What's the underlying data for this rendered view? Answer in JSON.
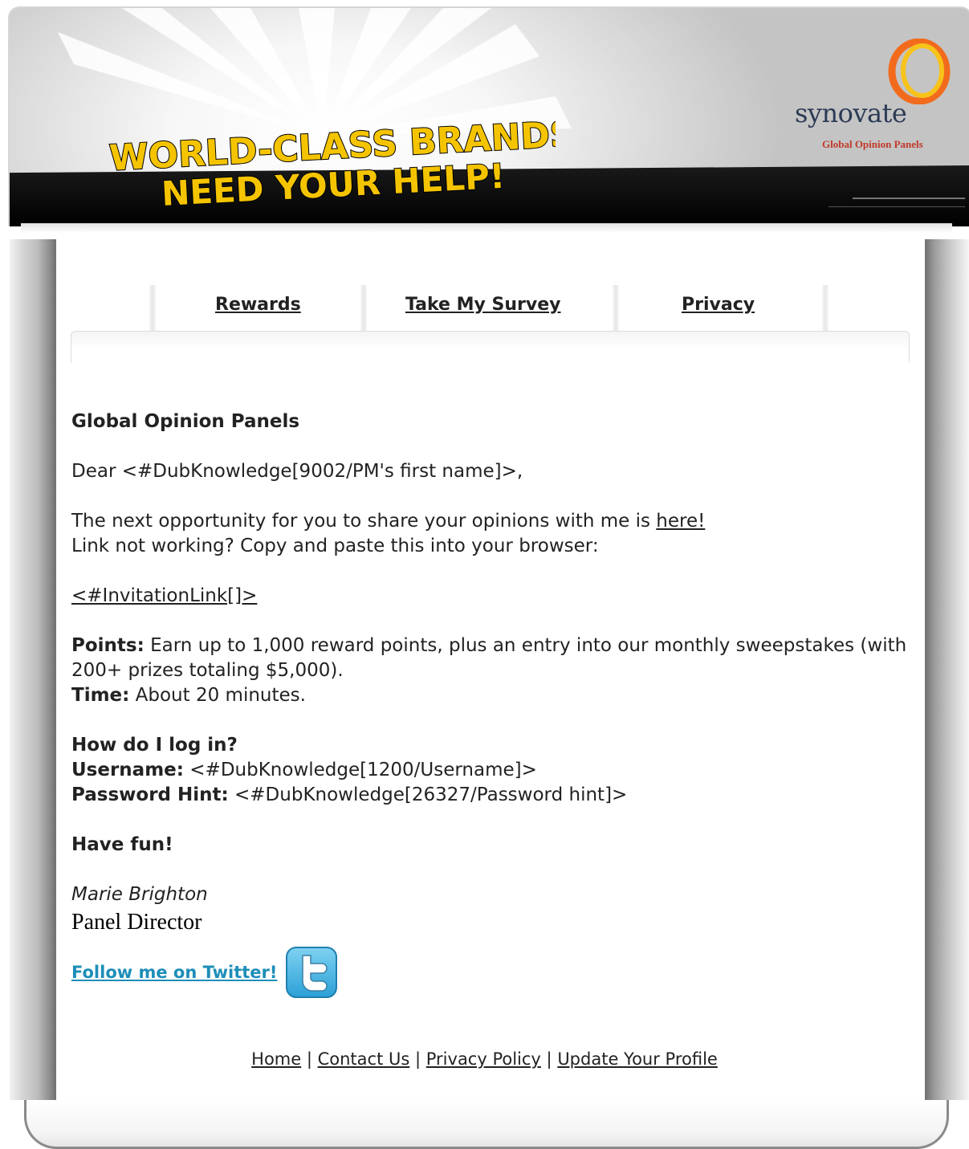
{
  "header": {
    "headline_line1": "WORLD-CLASS BRANDS",
    "headline_line2": "NEED YOUR HELP!",
    "logo_word": "synovate",
    "logo_sub": "Global Opinion Panels",
    "colors": {
      "headline": "#f5c400",
      "ring_outer": "#f26b1d",
      "ring_inner": "#f7c31a",
      "logo_text": "#2b3a55"
    }
  },
  "nav": {
    "items": [
      {
        "label": "Rewards"
      },
      {
        "label": "Take My Survey"
      },
      {
        "label": "Privacy"
      }
    ]
  },
  "body": {
    "title": "Global Opinion Panels",
    "greeting": "Dear <#DubKnowledge[9002/PM's first name]>,",
    "opportunity_text": "The next opportunity for you to share your opinions with me is ",
    "opportunity_link": "here!",
    "link_help": "Link not working? Copy and paste this into your browser:",
    "invitation_link": "<#InvitationLink[]>",
    "points_label": "Points:",
    "points_text": " Earn up to 1,000 reward points, plus an entry into our monthly sweepstakes (with 200+ prizes totaling $5,000).",
    "time_label": "Time:",
    "time_text": " About 20 minutes.",
    "login_heading": "How do I log in?",
    "username_label": "Username:",
    "username_value": " <#DubKnowledge[1200/Username]>",
    "password_label": "Password Hint:",
    "password_value": " <#DubKnowledge[26327/Password hint]>",
    "closing": "Have fun!",
    "signature_name": "Marie Brighton",
    "signature_title": "Panel Director",
    "twitter_label": "Follow me on Twitter! ",
    "twitter_icon": "twitter-icon"
  },
  "footer": {
    "links": [
      "Home",
      "Contact Us",
      "Privacy Policy",
      "Update Your Profile"
    ],
    "separator": " | "
  }
}
